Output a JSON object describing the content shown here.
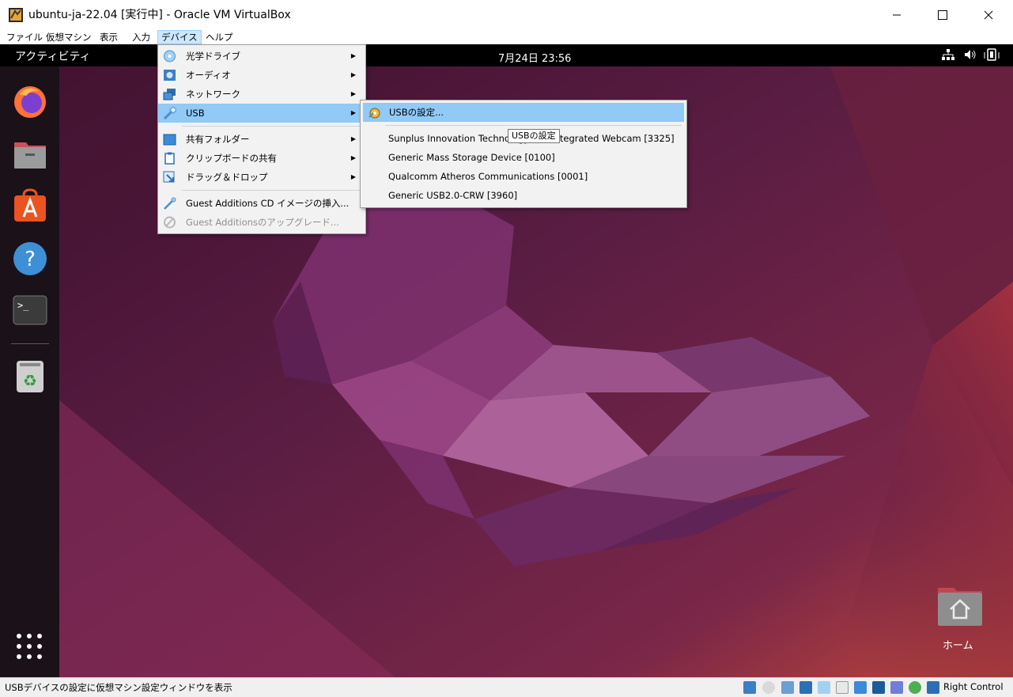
{
  "window": {
    "title": "ubuntu-ja-22.04 [実行中] - Oracle VM VirtualBox",
    "icon": "virtualbox-icon"
  },
  "menubar": [
    "ファイル",
    "仮想マシン",
    "表示",
    "入力",
    "デバイス",
    "ヘルプ"
  ],
  "menubar_active": "デバイス",
  "ubuntu": {
    "activities": "アクティビティ",
    "clock": "7月24日  23:56",
    "home_label": "ホーム",
    "dock_apps": [
      "firefox-icon",
      "files-icon",
      "app-center-icon",
      "help-icon",
      "terminal-icon",
      "trash-icon"
    ]
  },
  "devices_menu": {
    "items": [
      {
        "label": "光学ドライブ",
        "submenu": true,
        "icon": "optical-drive-icon"
      },
      {
        "label": "オーディオ",
        "submenu": true,
        "icon": "audio-icon"
      },
      {
        "label": "ネットワーク",
        "submenu": true,
        "icon": "network-icon"
      },
      {
        "label": "USB",
        "submenu": true,
        "icon": "usb-icon",
        "highlighted": true
      },
      {
        "label": "共有フォルダー",
        "submenu": true,
        "icon": "shared-folder-icon"
      },
      {
        "label": "クリップボードの共有",
        "submenu": true,
        "icon": "clipboard-icon"
      },
      {
        "label": "ドラッグ＆ドロップ",
        "submenu": true,
        "icon": "drag-drop-icon"
      },
      {
        "label": "Guest Additions CD イメージの挿入...",
        "submenu": false,
        "icon": "cd-insert-icon"
      },
      {
        "label": "Guest Additionsのアップグレード...",
        "submenu": false,
        "icon": "upgrade-icon",
        "disabled": true
      }
    ]
  },
  "usb_submenu": {
    "settings": "USBの設定...",
    "devices": [
      "Sunplus Innovation Technology Inc. Integrated Webcam [3325]",
      "Generic Mass Storage Device [0100]",
      "Qualcomm Atheros Communications  [0001]",
      "Generic USB2.0-CRW [3960]"
    ]
  },
  "tooltip": "USBの設定",
  "statusbar": {
    "text": "USBデバイスの設定に仮想マシン設定ウィンドウを表示",
    "host_key": "Right Control"
  }
}
